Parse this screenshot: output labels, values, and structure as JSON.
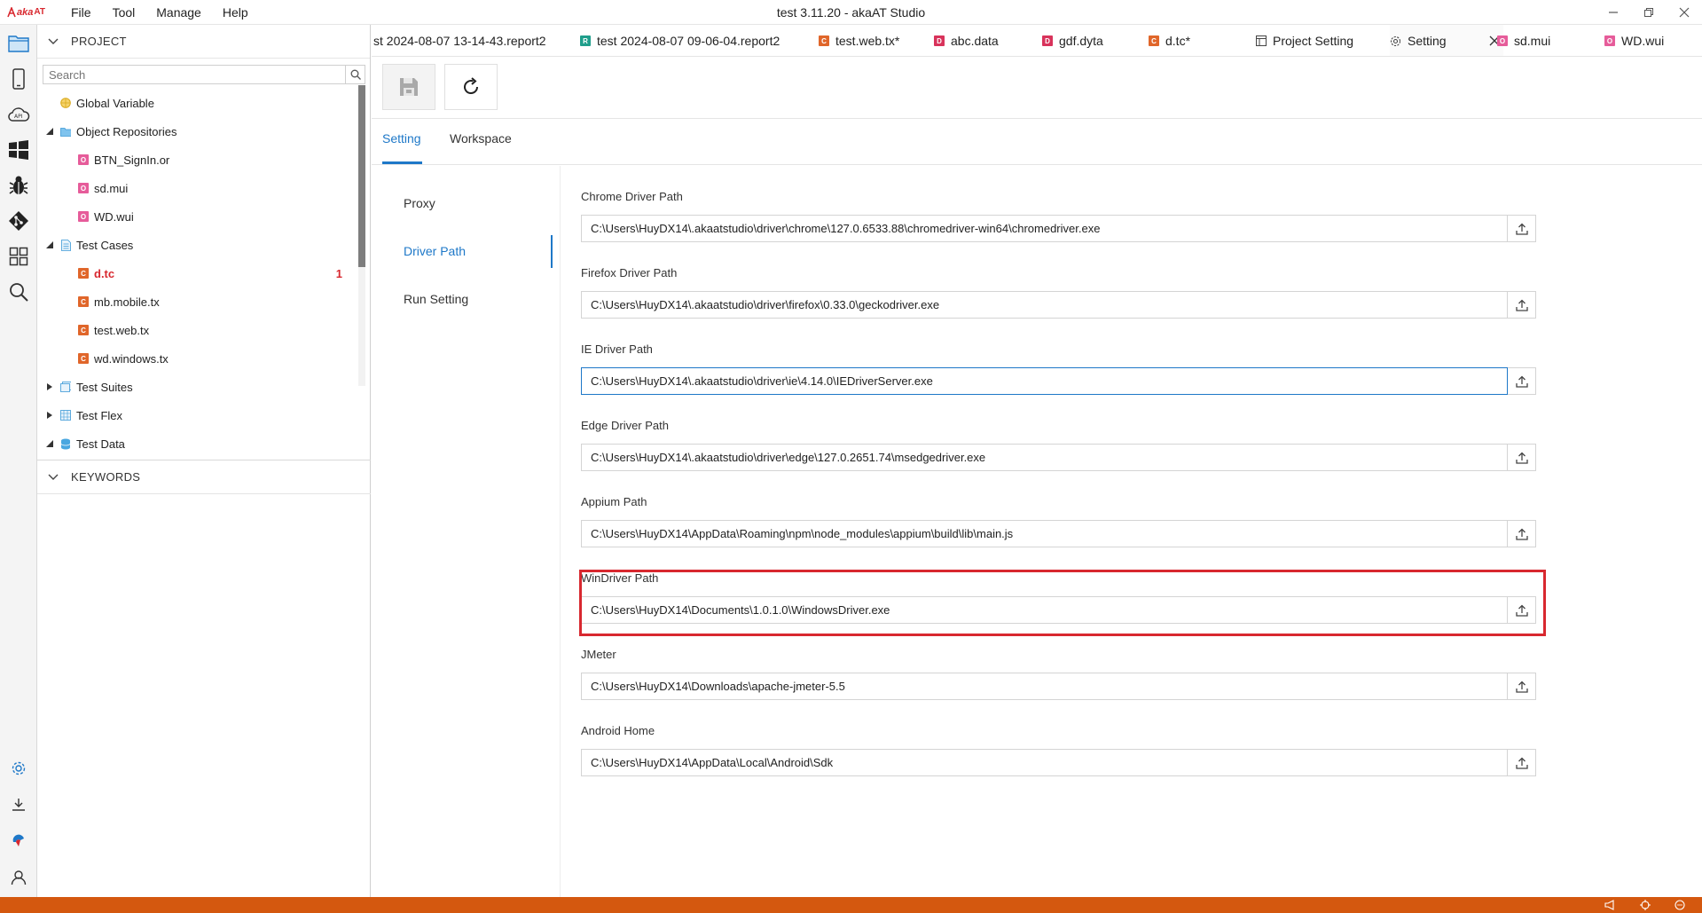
{
  "app": {
    "logo_text": "aka",
    "logo_suffix": "AT",
    "window_title": "test 3.11.20 - akaAT Studio",
    "menu": [
      "File",
      "Tool",
      "Manage",
      "Help"
    ]
  },
  "sidebar": {
    "project_header": "PROJECT",
    "search_placeholder": "Search",
    "tree": [
      {
        "label": "Global Variable",
        "icon": "globe-icon"
      },
      {
        "label": "Object Repositories",
        "icon": "folder-icon"
      },
      {
        "label": "BTN_SignIn.or",
        "icon": "O"
      },
      {
        "label": "sd.mui",
        "icon": "O"
      },
      {
        "label": "WD.wui",
        "icon": "O"
      },
      {
        "label": "Test Cases",
        "icon": "document-icon"
      },
      {
        "label": "d.tc",
        "icon": "C",
        "badge": "1"
      },
      {
        "label": "mb.mobile.tx",
        "icon": "C"
      },
      {
        "label": "test.web.tx",
        "icon": "C"
      },
      {
        "label": "wd.windows.tx",
        "icon": "C"
      },
      {
        "label": "Test Suites",
        "icon": "suite-icon"
      },
      {
        "label": "Test Flex",
        "icon": "grid-icon"
      },
      {
        "label": "Test Data",
        "icon": "database-icon"
      }
    ],
    "keywords_header": "KEYWORDS"
  },
  "tabs": [
    {
      "label": "st 2024-08-07 13-14-43.report2",
      "icon": ""
    },
    {
      "label": "test 2024-08-07 09-06-04.report2",
      "icon": "R"
    },
    {
      "label": "test.web.tx*",
      "icon": "C"
    },
    {
      "label": "abc.data",
      "icon": "D"
    },
    {
      "label": "gdf.dyta",
      "icon": "D"
    },
    {
      "label": "d.tc*",
      "icon": "C"
    },
    {
      "label": "Project Setting",
      "icon": "settings-page-icon"
    },
    {
      "label": "Setting",
      "icon": "gear-icon"
    },
    {
      "label": "sd.mui",
      "icon": "O"
    },
    {
      "label": "WD.wui",
      "icon": "O"
    }
  ],
  "setting_tabs": [
    "Setting",
    "Workspace"
  ],
  "setting_nav": [
    "Proxy",
    "Driver Path",
    "Run Setting"
  ],
  "fields": [
    {
      "label": "Chrome Driver Path",
      "value": "C:\\Users\\HuyDX14\\.akaatstudio\\driver\\chrome\\127.0.6533.88\\chromedriver-win64\\chromedriver.exe"
    },
    {
      "label": "Firefox Driver Path",
      "value": "C:\\Users\\HuyDX14\\.akaatstudio\\driver\\firefox\\0.33.0\\geckodriver.exe"
    },
    {
      "label": "IE Driver Path",
      "value": "C:\\Users\\HuyDX14\\.akaatstudio\\driver\\ie\\4.14.0\\IEDriverServer.exe"
    },
    {
      "label": "Edge Driver Path",
      "value": "C:\\Users\\HuyDX14\\.akaatstudio\\driver\\edge\\127.0.2651.74\\msedgedriver.exe"
    },
    {
      "label": "Appium Path",
      "value": "C:\\Users\\HuyDX14\\AppData\\Roaming\\npm\\node_modules\\appium\\build\\lib\\main.js"
    },
    {
      "label": "WinDriver Path",
      "value": "C:\\Users\\HuyDX14\\Documents\\1.0.1.0\\WindowsDriver.exe"
    },
    {
      "label": "JMeter",
      "value": "C:\\Users\\HuyDX14\\Downloads\\apache-jmeter-5.5"
    },
    {
      "label": "Android Home",
      "value": "C:\\Users\\HuyDX14\\AppData\\Local\\Android\\Sdk"
    }
  ],
  "colors": {
    "accent": "#1e78c8",
    "status_bar": "#d4580f",
    "highlight": "#d8282f"
  }
}
